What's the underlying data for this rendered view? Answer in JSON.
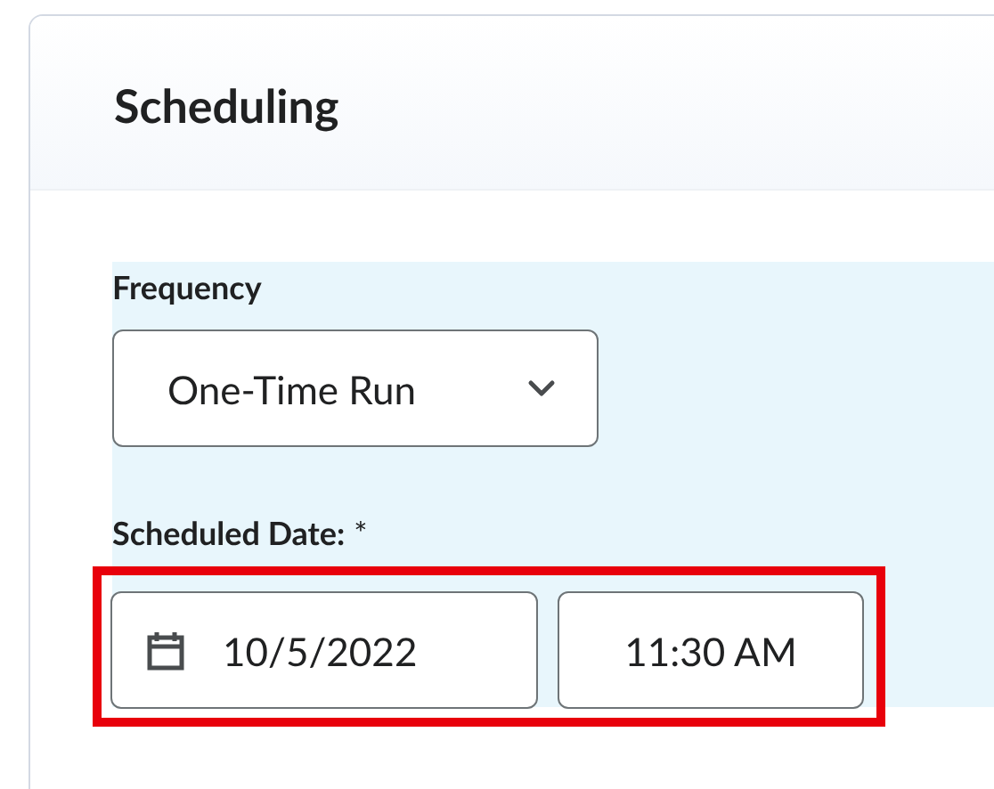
{
  "panel": {
    "title": "Scheduling"
  },
  "frequency": {
    "label": "Frequency",
    "value": "One-Time Run"
  },
  "scheduled_date": {
    "label": "Scheduled Date:",
    "required_mark": "*",
    "date": "10/5/2022",
    "time": "11:30 AM"
  }
}
